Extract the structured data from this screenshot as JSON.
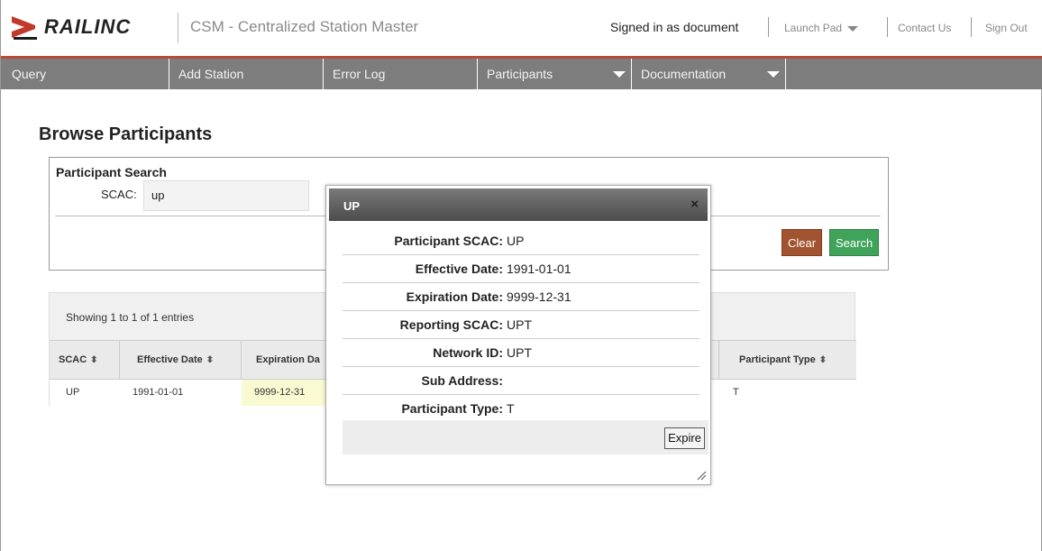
{
  "header": {
    "logo_text": "RAILINC",
    "app_title": "CSM - Centralized Station Master",
    "signed_in": "Signed in as document",
    "links": {
      "launch_pad": "Launch Pad",
      "contact_us": "Contact Us",
      "sign_out": "Sign Out"
    }
  },
  "nav": [
    "Query",
    "Add Station",
    "Error Log",
    "Participants",
    "Documentation"
  ],
  "page": {
    "title": "Browse Participants"
  },
  "search": {
    "legend": "Participant Search",
    "scac_label": "SCAC:",
    "scac_value": "up",
    "clear_label": "Clear",
    "search_label": "Search"
  },
  "results": {
    "showing": "Showing 1 to 1 of 1 entries",
    "columns": [
      "SCAC",
      "Effective Date",
      "Expiration Da",
      "Participant Type"
    ],
    "row": {
      "scac": "UP",
      "effective": "1991-01-01",
      "expiration": "9999-12-31",
      "type": "T"
    }
  },
  "dialog": {
    "title": "UP",
    "close": "×",
    "fields": [
      {
        "label": "Participant SCAC:",
        "value": "UP"
      },
      {
        "label": "Effective Date:",
        "value": "1991-01-01"
      },
      {
        "label": "Expiration Date:",
        "value": "9999-12-31"
      },
      {
        "label": "Reporting SCAC:",
        "value": "UPT"
      },
      {
        "label": "Network ID:",
        "value": "UPT"
      },
      {
        "label": "Sub Address:",
        "value": ""
      },
      {
        "label": "Participant Type:",
        "value": "T"
      }
    ],
    "expire_label": "Expire"
  },
  "colors": {
    "accent_red": "#b74a3a",
    "nav_gray": "#7d7d7d",
    "clear_brown": "#a1542f",
    "search_green": "#3fa35a"
  }
}
